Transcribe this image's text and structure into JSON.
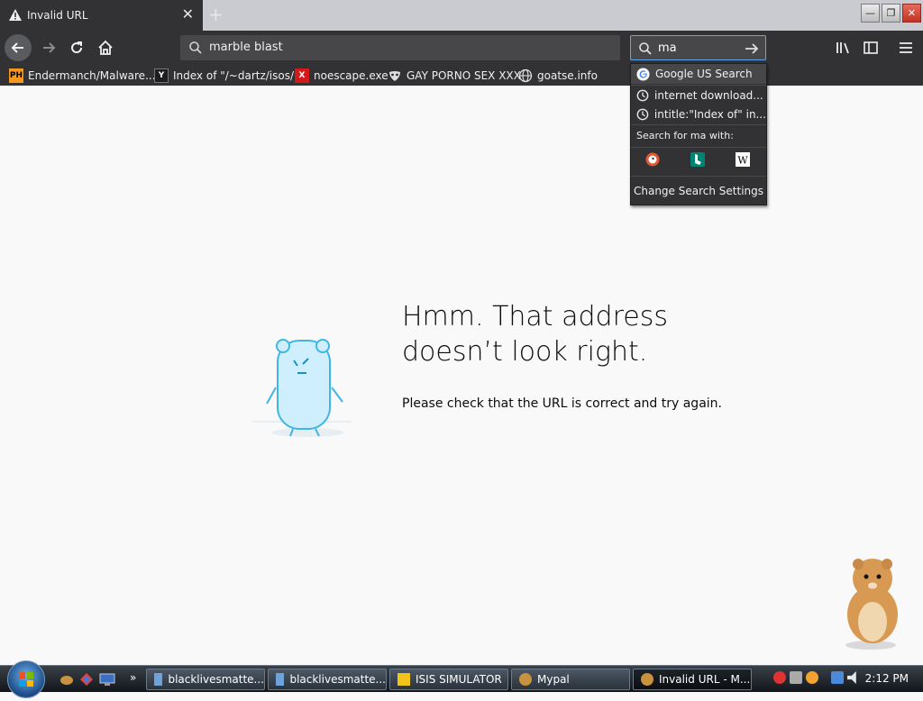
{
  "tab": {
    "title": "Invalid URL",
    "close": "✕",
    "new_tab": "+"
  },
  "window_controls": {
    "minimize": "—",
    "restore": "❐",
    "close": "✕"
  },
  "urlbar": {
    "value": "marble blast"
  },
  "searchbar": {
    "value": "ma"
  },
  "bookmarks": [
    {
      "label": "Endermanch/Malware...",
      "icon": "PH"
    },
    {
      "label": "Index of \"/~dartz/isos/\"",
      "icon": "Y"
    },
    {
      "label": "noescape.exe",
      "icon": "X"
    },
    {
      "label": "GAY PORNO SEX XXX",
      "icon": "mask"
    },
    {
      "label": "goatse.info",
      "icon": "globe"
    }
  ],
  "search_dropdown": {
    "engine_suggestion": "Google US Search",
    "history": [
      "internet download...",
      "intitle:\"Index of\" in..."
    ],
    "search_for_label": "Search for ma with:",
    "settings": "Change Search Settings"
  },
  "error_page": {
    "title_line1": "Hmm. That address",
    "title_line2": "doesn’t look right.",
    "description": "Please check that the URL is correct and try again."
  },
  "taskbar": {
    "tasks": [
      {
        "label": "blacklivesmatte...",
        "active": false
      },
      {
        "label": "blacklivesmatte...",
        "active": false
      },
      {
        "label": "ISIS SIMULATOR",
        "active": false
      },
      {
        "label": "Mypal",
        "active": false
      },
      {
        "label": "Invalid URL - M...",
        "active": true
      }
    ],
    "clock": "2:12 PM",
    "overflow": "»"
  }
}
